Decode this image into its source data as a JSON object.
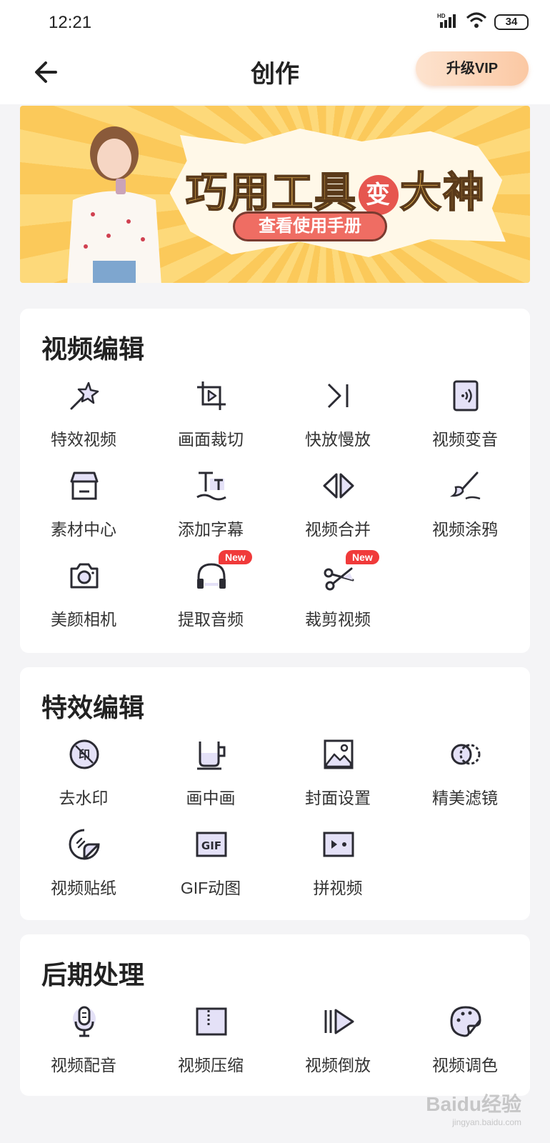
{
  "status": {
    "time": "12:21",
    "network": "HD",
    "battery": "34"
  },
  "header": {
    "title": "创作",
    "vip_label": "升级VIP"
  },
  "banner": {
    "title_part1": "巧用工具",
    "title_badge": "变",
    "title_part2": "大神",
    "button": "查看使用手册"
  },
  "sections": [
    {
      "title": "视频编辑",
      "items": [
        {
          "label": "特效视频",
          "icon": "magic-wand-icon"
        },
        {
          "label": "画面裁切",
          "icon": "crop-icon"
        },
        {
          "label": "快放慢放",
          "icon": "speed-icon"
        },
        {
          "label": "视频变音",
          "icon": "voice-change-icon"
        },
        {
          "label": "素材中心",
          "icon": "store-icon"
        },
        {
          "label": "添加字幕",
          "icon": "subtitle-icon"
        },
        {
          "label": "视频合并",
          "icon": "merge-icon"
        },
        {
          "label": "视频涂鸦",
          "icon": "brush-icon"
        },
        {
          "label": "美颜相机",
          "icon": "camera-icon"
        },
        {
          "label": "提取音频",
          "icon": "headphones-icon",
          "badge": "New"
        },
        {
          "label": "裁剪视频",
          "icon": "scissors-icon",
          "badge": "New"
        }
      ]
    },
    {
      "title": "特效编辑",
      "items": [
        {
          "label": "去水印",
          "icon": "remove-watermark-icon"
        },
        {
          "label": "画中画",
          "icon": "pip-cup-icon"
        },
        {
          "label": "封面设置",
          "icon": "cover-image-icon"
        },
        {
          "label": "精美滤镜",
          "icon": "filter-icon"
        },
        {
          "label": "视频贴纸",
          "icon": "sticker-icon"
        },
        {
          "label": "GIF动图",
          "icon": "gif-icon"
        },
        {
          "label": "拼视频",
          "icon": "collage-video-icon"
        }
      ]
    },
    {
      "title": "后期处理",
      "items": [
        {
          "label": "视频配音",
          "icon": "microphone-icon"
        },
        {
          "label": "视频压缩",
          "icon": "compress-icon"
        },
        {
          "label": "视频倒放",
          "icon": "reverse-play-icon"
        },
        {
          "label": "视频调色",
          "icon": "palette-icon"
        }
      ]
    }
  ],
  "watermark": {
    "brand": "Baidu经验",
    "url": "jingyan.baidu.com"
  },
  "colors": {
    "accent_vip": "#fbc8a3",
    "badge_red": "#f03a3a",
    "icon_stroke": "#2b2b33",
    "icon_fill": "#e4e1f7"
  }
}
